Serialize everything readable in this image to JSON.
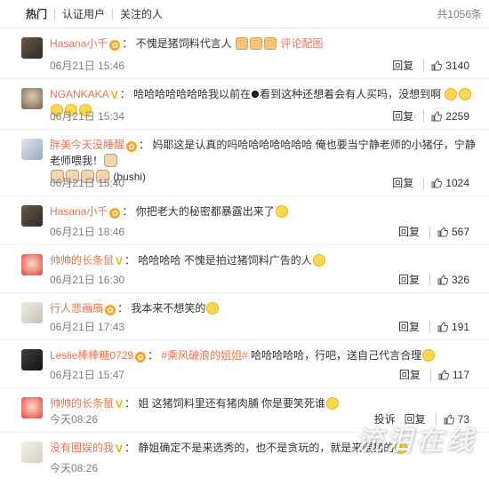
{
  "tabs": [
    {
      "label": "热门"
    },
    {
      "label": "认证用户"
    },
    {
      "label": "关注的人"
    }
  ],
  "total_count": "共1056条",
  "comments": [
    {
      "nick": "Hasana小千",
      "badge": "✿",
      "pre": "：",
      "text": "不愧是猪饲料代言人",
      "link": "评论配图",
      "time": "06月21日 15:46",
      "reply": "回复",
      "likes": "3140"
    },
    {
      "nick": "NGANKAKA",
      "badge": "V",
      "pre": "：",
      "text": "哈哈哈哈哈哈哈我以前在",
      "text2": "看到这种还想着会有人买吗，没想到啊",
      "time": "06月21日 15:34",
      "reply": "回复",
      "likes": "2259"
    },
    {
      "nick": "胖美今天没睡醒",
      "badge": "✿",
      "pre": "：",
      "text": "妈耶这是认真的吗哈哈哈哈哈哈哈 俺也要当宁静老师的小猪仔，宁静老师喂我！",
      "text2": "(bushi)",
      "time": "06月21日 15:40",
      "reply": "回复",
      "likes": "1024"
    },
    {
      "nick": "Hasana小千",
      "badge": "✿",
      "pre": "：",
      "text": "你把老大的秘密都暴露出来了",
      "time": "06月21日 18:46",
      "reply": "回复",
      "likes": "567"
    },
    {
      "nick": "帅帅的长条鼠",
      "badge": "V",
      "pre": "：",
      "text": "哈哈哈哈 不愧是拍过猪饲料广告的人",
      "time": "06月21日 16:30",
      "reply": "回复",
      "likes": "326"
    },
    {
      "nick": "行人悲画扇",
      "badge": "✿",
      "pre": "：",
      "text": "我本来不想笑的",
      "time": "06月21日 17:43",
      "reply": "回复",
      "likes": "191"
    },
    {
      "nick": "Leslie棒棒糖0729",
      "badge": "✿",
      "pre": "：",
      "link": "#乘风破浪的姐姐#",
      "text": " 哈哈哈哈哈，行吧，送自己代言合理",
      "time": "06月21日 15:47",
      "reply": "回复",
      "likes": "117"
    },
    {
      "nick": "帅帅的长条鼠",
      "badge": "V",
      "pre": "：",
      "text": "姐 这猪饲料里还有猪肉脯 你是要笑死谁",
      "time": "今天08:26",
      "report": "投诉",
      "reply": "回复",
      "likes": "73"
    },
    {
      "nick": "没有圈娱的我",
      "badge": "V",
      "pre": "：",
      "text": "静姐确定不是来选秀的，也不是贪玩的，就是来喂猪的",
      "time": "今天08:26"
    }
  ],
  "watermark": "流泪在线",
  "colors": {
    "nick": "#eb7350",
    "muted": "#808080",
    "badge_gold": "#f5a623"
  }
}
